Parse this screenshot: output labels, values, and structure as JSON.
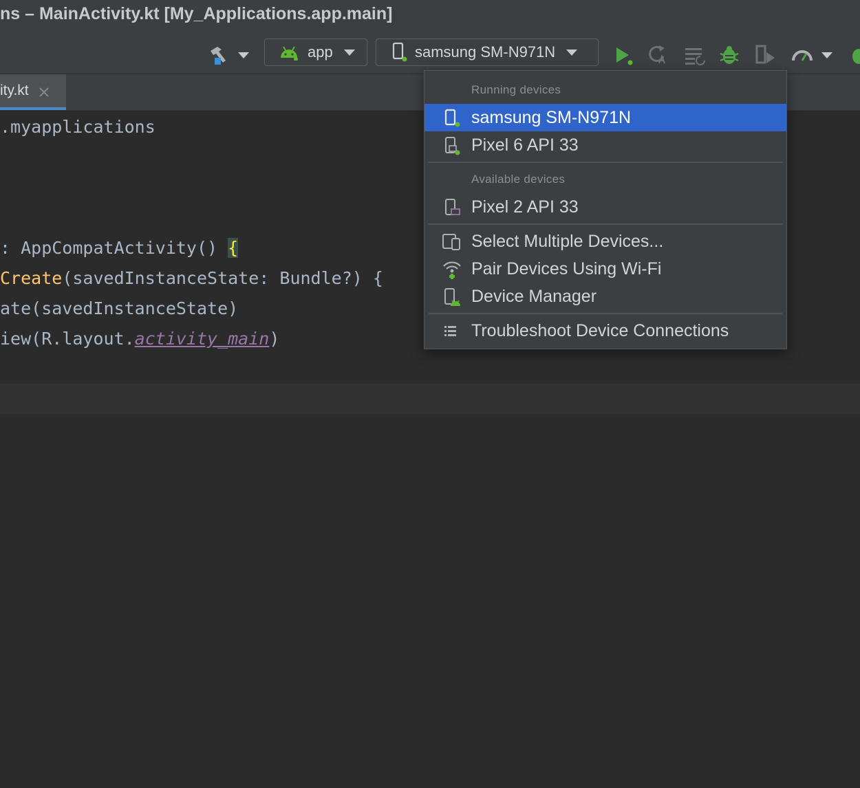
{
  "window": {
    "title": "ns – MainActivity.kt [My_Applications.app.main]"
  },
  "toolbar": {
    "run_config": "app",
    "device": "samsung SM-N971N"
  },
  "tabs": [
    {
      "label": "ity.kt"
    }
  ],
  "editor": {
    "lines": [
      ".myapplications",
      ": AppCompatActivity() ",
      "{",
      "Create",
      "(savedInstanceState: Bundle?) {",
      "ate(savedInstanceState)",
      "iew(R.layout.",
      "activity_main",
      ")"
    ]
  },
  "device_menu": {
    "running_header": "Running devices",
    "running": [
      {
        "label": "samsung SM-N971N",
        "icon": "phone-running-icon",
        "selected": true
      },
      {
        "label": "Pixel 6 API 33",
        "icon": "emulator-running-icon",
        "selected": false
      }
    ],
    "available_header": "Available devices",
    "available": [
      {
        "label": "Pixel 2 API 33",
        "icon": "emulator-icon"
      }
    ],
    "actions": [
      {
        "label": "Select Multiple Devices...",
        "icon": "multiple-devices-icon"
      },
      {
        "label": "Pair Devices Using Wi-Fi",
        "icon": "wifi-pair-icon"
      },
      {
        "label": "Device Manager",
        "icon": "device-manager-icon"
      }
    ],
    "troubleshoot": {
      "label": "Troubleshoot Device Connections",
      "icon": "list-icon"
    }
  },
  "colors": {
    "accent": "#2f65ca",
    "android_green": "#5fb832",
    "run_green": "#4fa545"
  }
}
